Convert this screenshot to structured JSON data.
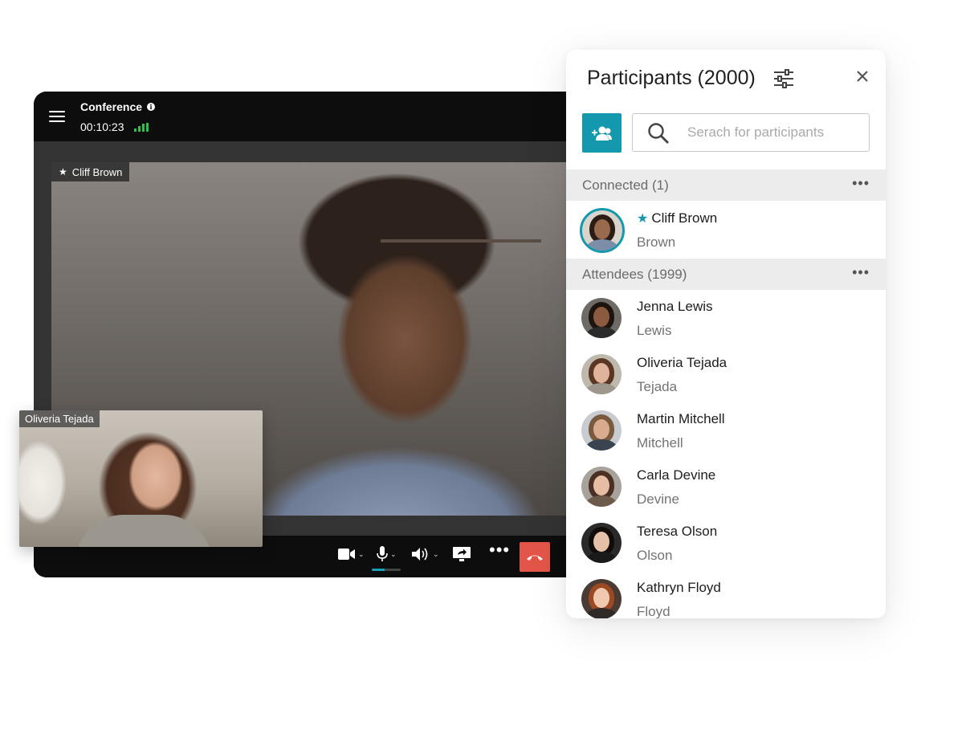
{
  "conference": {
    "title": "Conference",
    "timer": "00:10:23",
    "speaker_label": "Cliff Brown",
    "self_view_label": "Oliveria Tejada",
    "mic_level_percent": 45,
    "colors": {
      "hangup": "#e45549",
      "signal": "#2fbf4c",
      "accent": "#1498ad"
    }
  },
  "panel": {
    "title": "Participants (2000)",
    "search": {
      "placeholder": "Serach for participants",
      "value": ""
    },
    "sections": {
      "connected": {
        "label": "Connected (1)",
        "items": [
          {
            "name": "Cliff Brown",
            "sub": "Brown",
            "presenter": true
          }
        ]
      },
      "attendees": {
        "label": "Attendees (1999)",
        "items": [
          {
            "name": "Jenna Lewis",
            "sub": "Lewis"
          },
          {
            "name": "Oliveria Tejada",
            "sub": "Tejada"
          },
          {
            "name": "Martin Mitchell",
            "sub": "Mitchell"
          },
          {
            "name": "Carla Devine",
            "sub": "Devine"
          },
          {
            "name": "Teresa Olson",
            "sub": "Olson"
          },
          {
            "name": "Kathryn Floyd",
            "sub": "Floyd"
          }
        ]
      }
    }
  },
  "icons": {
    "menu": "menu-icon",
    "info": "info-icon",
    "signal": "signal-icon",
    "camera": "camera-icon",
    "microphone": "microphone-icon",
    "speaker": "speaker-icon",
    "screen_share": "screen-share-icon",
    "more": "more-icon",
    "hangup": "hangup-icon",
    "settings": "sliders-icon",
    "close": "close-icon",
    "add_participant": "add-participant-icon",
    "search": "search-icon",
    "star": "star-icon"
  }
}
